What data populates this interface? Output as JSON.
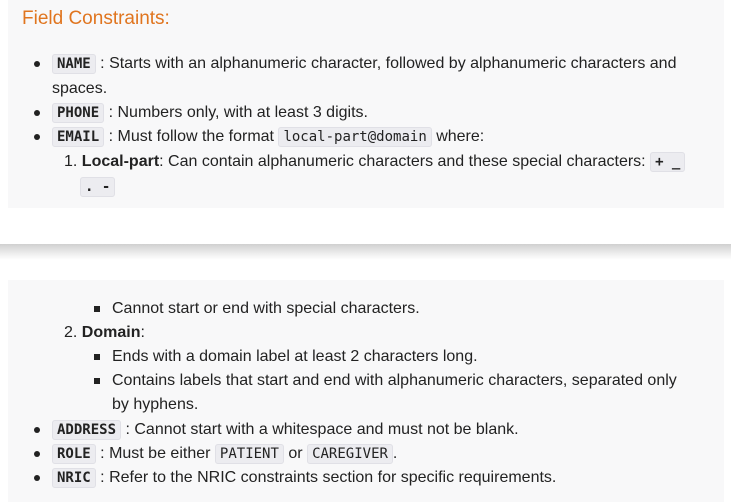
{
  "heading": "Field Constraints:",
  "name": {
    "code": "NAME",
    "text1": ": Starts with an alphanumeric character, followed by alphanumeric characters and",
    "text2": "spaces."
  },
  "phone": {
    "code": "PHONE",
    "text": ": Numbers only, with at least 3 digits."
  },
  "email": {
    "code": "EMAIL",
    "text1": ": Must follow the format",
    "format": "local-part@domain",
    "text2": "where:"
  },
  "local_part": {
    "num": "1.",
    "label": "Local-part",
    "text": ": Can contain alphanumeric characters and these special characters:",
    "chars1": "+ _",
    "chars2": ". -",
    "sub1": "Cannot start or end with special characters."
  },
  "domain": {
    "num": "2.",
    "label": "Domain",
    "colon": ":",
    "sub1": "Ends with a domain label at least 2 characters long.",
    "sub2a": "Contains labels that start and end with alphanumeric characters, separated only",
    "sub2b": "by hyphens."
  },
  "address": {
    "code": "ADDRESS",
    "text": ": Cannot start with a whitespace and must not be blank."
  },
  "role": {
    "code": "ROLE",
    "text1": ": Must be either",
    "opt1": "PATIENT",
    "or": "or",
    "opt2": "CAREGIVER",
    "end": "."
  },
  "nric": {
    "code": "NRIC",
    "text": ": Refer to the NRIC constraints section for specific requirements."
  }
}
